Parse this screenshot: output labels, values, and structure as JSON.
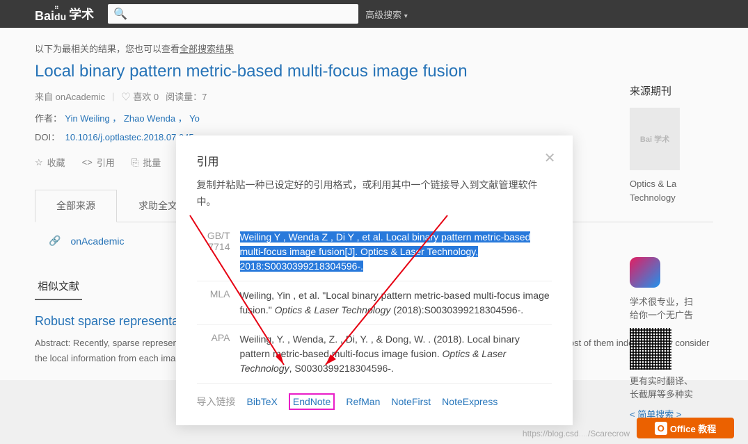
{
  "topbar": {
    "logo_text": "Bai",
    "logo_suffix": "学术",
    "adv_search": "高级搜索"
  },
  "result_hint": {
    "prefix": "以下为最相关的结果，您也可以查看",
    "link": "全部搜索结果"
  },
  "title": "Local binary pattern metric-based multi-focus image fusion",
  "meta": {
    "source": "来自 onAcademic",
    "like_label": "喜欢",
    "like_count": "0",
    "reads_label": "阅读量：",
    "reads_count": "7"
  },
  "authors": {
    "label": "作者：",
    "list": "Yin Weiling ， Zhao Wenda ， Yo"
  },
  "doi": {
    "label": "DOI：",
    "value": "10.1016/j.optlastec.2018.07.045"
  },
  "actions": {
    "fav": "收藏",
    "cite": "引用",
    "batch": "批量"
  },
  "tabs": {
    "all_sources": "全部来源",
    "request": "求助全文"
  },
  "source_link": "onAcademic",
  "related_section": "相似文献",
  "related_title": "Robust sparse representation construction and local spatial",
  "abstract": "Abstract: Recently, sparse representation-based (SR) methods have been presented for the fusion of multi-focus images. However, most of them independently consider the local information from each image patch during sparse coding and",
  "sidebar": {
    "head": "来源期刊",
    "journal": "Optics & La\nTechnology",
    "thumb_logo": "Bai 学术"
  },
  "promo": {
    "line1": "学术很专业，扫",
    "line2": "给你一个无广告",
    "line3": "更有实时翻译、",
    "line4": "长截屏等多种实",
    "link": "< 简单搜索 >"
  },
  "modal": {
    "title": "引用",
    "hint": "复制并粘贴一种已设定好的引用格式，或利用其中一个链接导入到文献管理软件中。",
    "citations": [
      {
        "label": "GB/T 7714",
        "text": "Weiling Y , Wenda Z , Di Y , et al. Local binary pattern metric-based multi-focus image fusion[J]. Optics & Laser Technology, 2018:S0030399218304596-.",
        "hl": true
      },
      {
        "label": "MLA",
        "pre": "Weiling, Yin , et al. \"Local binary pattern metric-based multi-focus image fusion.\" ",
        "em": "Optics & Laser Technology",
        "post": " (2018):S0030399218304596-."
      },
      {
        "label": "APA",
        "pre": "Weiling, Y. , Wenda, Z. , Di, Y. , & Dong, W. . (2018). Local binary pattern metric-based multi-focus image fusion. ",
        "em": "Optics & Laser Technology",
        "post": ", S0030399218304596-."
      }
    ],
    "export_label": "导入链接",
    "exports": [
      "BibTeX",
      "EndNote",
      "RefMan",
      "NoteFirst",
      "NoteExpress"
    ]
  },
  "watermark": "https://blog.csd",
  "watermark2": "/Scarecrow",
  "office_logo": "Office 教程"
}
